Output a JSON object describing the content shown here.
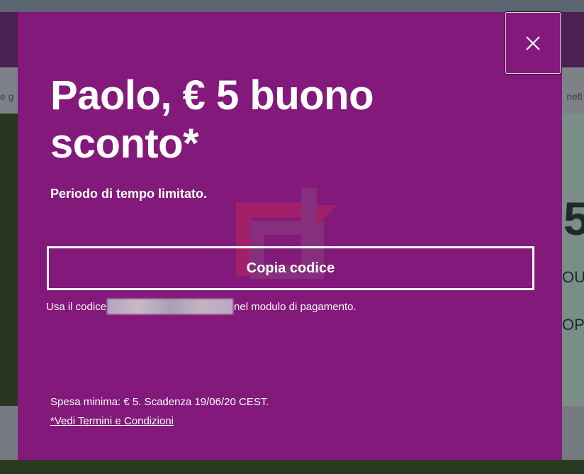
{
  "background": {
    "nav_left_fragment": "e g",
    "nav_right_fragment": "nefi",
    "hero_fragments": {
      "large": "5",
      "middle": "OU",
      "lower": "OPO"
    }
  },
  "modal": {
    "title": "Paolo, € 5 buono sconto*",
    "subtitle": "Periodo di tempo limitato.",
    "copy_button_label": "Copia codice",
    "code_prefix": "Usa il codice",
    "code_suffix": "nel modulo di pagamento.",
    "fine_print": "Spesa minima: € 5. Scadenza 19/06/20 CEST.",
    "terms_link": "*Vedi Termini e Condizioni",
    "close_icon": "close-icon"
  },
  "colors": {
    "modal_background": "#83197a",
    "text": "#ffffff",
    "header_background": "#4a2150"
  }
}
